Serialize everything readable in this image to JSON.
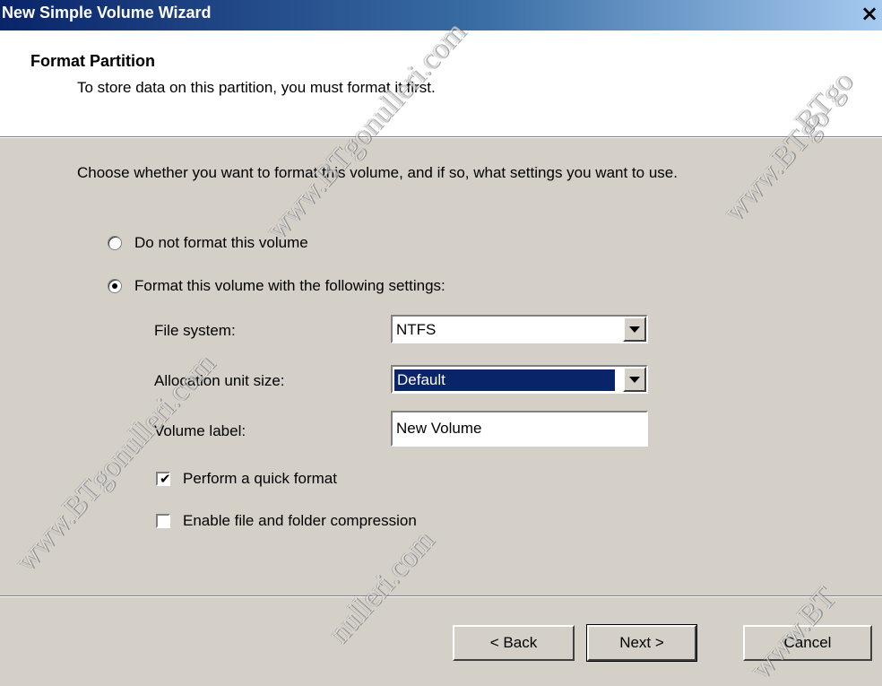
{
  "window": {
    "title": "New Simple Volume Wizard",
    "close_glyph": "×"
  },
  "header": {
    "title": "Format Partition",
    "subtitle": "To store data on this partition, you must format it first."
  },
  "body": {
    "intro": "Choose whether you want to format this volume, and if so, what settings you want to use.",
    "options": {
      "no_format": {
        "label": "Do not format this volume",
        "selected": false
      },
      "format": {
        "label": "Format this volume with the following settings:",
        "selected": true
      }
    },
    "fields": {
      "file_system": {
        "label": "File system:",
        "value": "NTFS"
      },
      "allocation": {
        "label": "Allocation unit size:",
        "value": "Default"
      },
      "volume_label": {
        "label": "Volume label:",
        "value": "New Volume"
      }
    },
    "checks": {
      "quick_format": {
        "label": "Perform a quick format",
        "checked": true
      },
      "compression": {
        "label": "Enable file and folder compression",
        "checked": false
      }
    }
  },
  "buttons": {
    "back": "< Back",
    "next": "Next >",
    "cancel": "Cancel"
  },
  "watermark": {
    "site": "www.BTgonulleri.com",
    "fragment_a": "www.BTgo",
    "fragment_b": "nulleri.com",
    "fragment_c": "BTgo",
    "fragment_d": "www.BT"
  },
  "colors": {
    "dialog_bg": "#d4d0c8",
    "title_start": "#0a246a",
    "title_end": "#a6caf0",
    "selection": "#0a246a"
  }
}
